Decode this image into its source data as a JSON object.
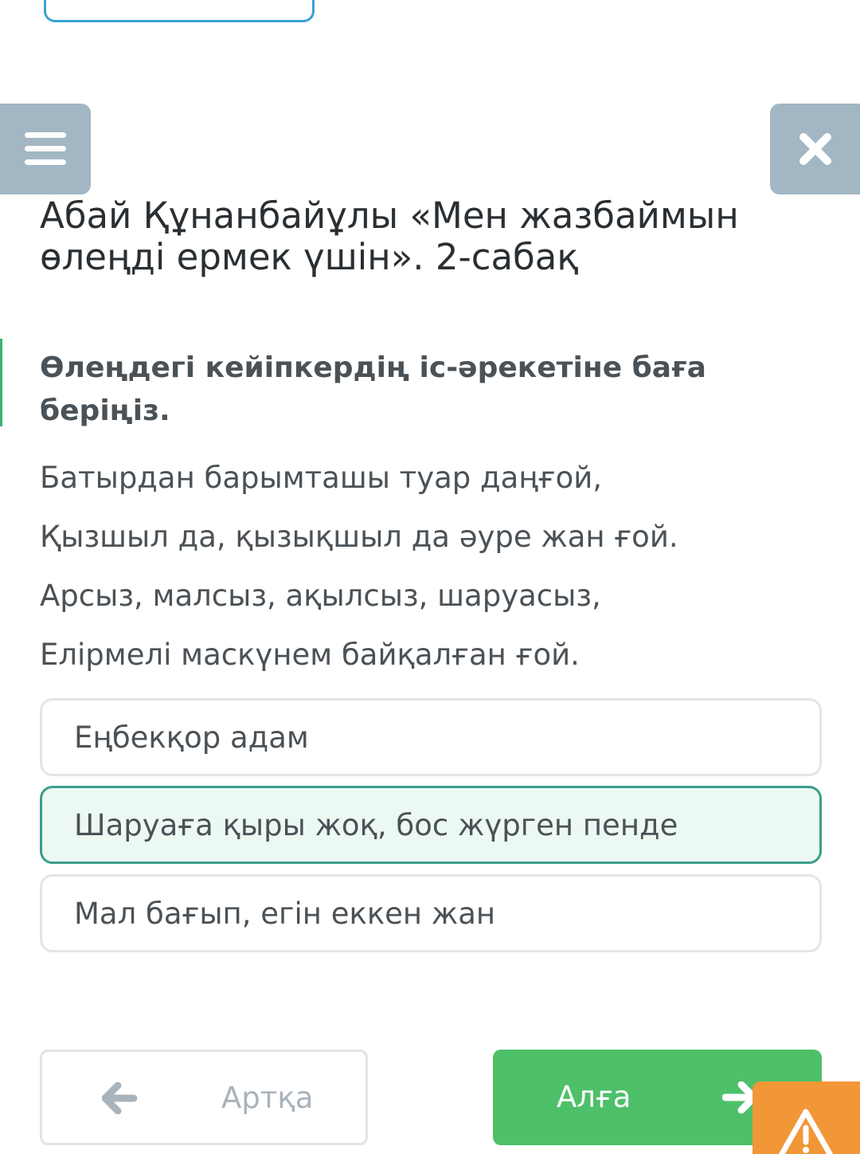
{
  "header": {
    "title": "Абай Құнанбайұлы «Мен жазбаймын өлеңді ермек үшін». 2-сабақ"
  },
  "question": {
    "prompt": "Өлеңдегі кейіпкердің іс-әрекетіне баға беріңіз.",
    "poem_lines": [
      "Батырдан барымташы туар даңғой,",
      "Қызшыл да, қызықшыл да әуре жан ғой.",
      "Арсыз, малсыз, ақылсыз, шаруасыз,",
      "Елірмелі маскүнем байқалған ғой."
    ]
  },
  "options": [
    {
      "label": "Еңбекқор адам",
      "selected": false
    },
    {
      "label": "Шаруаға қыры жоқ, бос жүрген пенде",
      "selected": true
    },
    {
      "label": "Мал бағып, егін еккен жан",
      "selected": false
    }
  ],
  "navigation": {
    "back_label": "Артқа",
    "next_label": "Алға"
  },
  "icons": {
    "menu": "hamburger-menu-icon",
    "close": "close-icon",
    "back": "arrow-left-icon",
    "next": "arrow-right-icon",
    "warning": "warning-icon"
  },
  "colors": {
    "icon_button_bg": "#a3b6c4",
    "selected_option_bg": "#ecf9f3",
    "selected_option_border": "#3a9e8c",
    "next_button": "#4ec06a",
    "warning_button": "#f29737",
    "top_tab_border": "#3aa1d6"
  }
}
